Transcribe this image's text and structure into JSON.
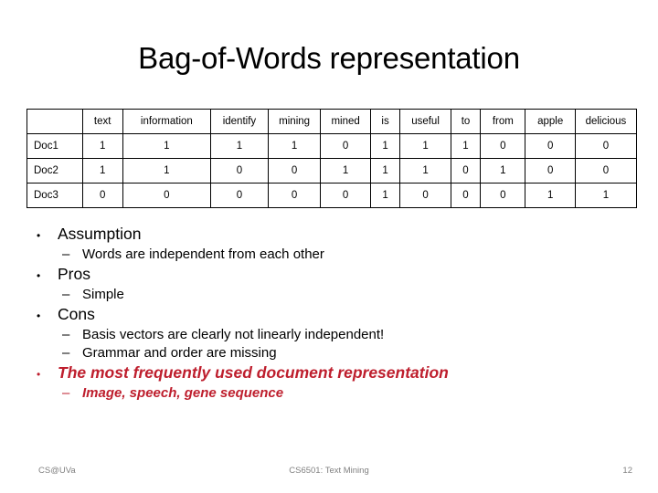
{
  "slide": {
    "title": "Bag-of-Words representation"
  },
  "table": {
    "corner_label": "",
    "columns": [
      "text",
      "information",
      "identify",
      "mining",
      "mined",
      "is",
      "useful",
      "to",
      "from",
      "apple",
      "delicious"
    ],
    "rows": [
      {
        "label": "Doc1",
        "values": [
          "1",
          "1",
          "1",
          "1",
          "0",
          "1",
          "1",
          "1",
          "0",
          "0",
          "0"
        ]
      },
      {
        "label": "Doc2",
        "values": [
          "1",
          "1",
          "0",
          "0",
          "1",
          "1",
          "1",
          "0",
          "1",
          "0",
          "0"
        ]
      },
      {
        "label": "Doc3",
        "values": [
          "0",
          "0",
          "0",
          "0",
          "0",
          "1",
          "0",
          "0",
          "0",
          "1",
          "1"
        ]
      }
    ]
  },
  "bullets": [
    {
      "level": 1,
      "marker": "•",
      "text": "Assumption",
      "accent": false
    },
    {
      "level": 2,
      "marker": "–",
      "text": "Words are independent from each other",
      "accent": false
    },
    {
      "level": 1,
      "marker": "•",
      "text": "Pros",
      "accent": false
    },
    {
      "level": 2,
      "marker": "–",
      "text": "Simple",
      "accent": false
    },
    {
      "level": 1,
      "marker": "•",
      "text": "Cons",
      "accent": false
    },
    {
      "level": 2,
      "marker": "–",
      "text": "Basis vectors are clearly not linearly independent!",
      "accent": false
    },
    {
      "level": 2,
      "marker": "–",
      "text": "Grammar and order are missing",
      "accent": false
    },
    {
      "level": 1,
      "marker": "•",
      "text": "The most frequently used document representation",
      "accent": true
    },
    {
      "level": 2,
      "marker": "–",
      "text": "Image, speech, gene sequence",
      "accent": true
    }
  ],
  "footer": {
    "left": "CS@UVa",
    "center": "CS6501: Text Mining",
    "page_number": "12"
  },
  "colors": {
    "accent_red": "#BE1E2D",
    "footer_gray": "#808080",
    "text_black": "#000000"
  }
}
